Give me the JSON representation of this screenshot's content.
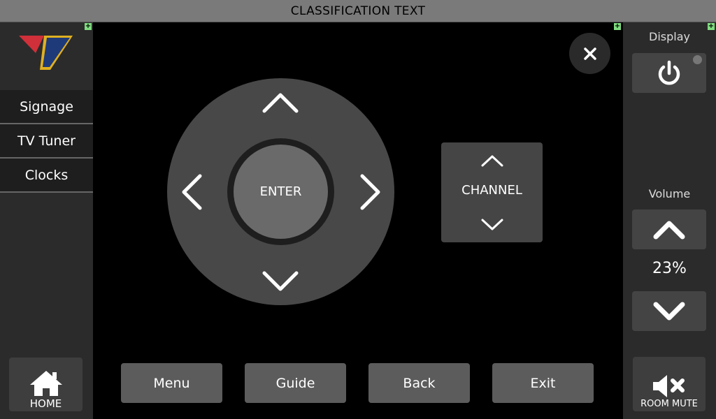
{
  "classification": "CLASSIFICATION TEXT",
  "nav": {
    "items": [
      {
        "label": "Signage"
      },
      {
        "label": "TV Tuner"
      },
      {
        "label": "Clocks"
      }
    ],
    "home_label": "HOME"
  },
  "dpad": {
    "enter_label": "ENTER"
  },
  "channel": {
    "label": "CHANNEL"
  },
  "bottom_buttons": {
    "menu": "Menu",
    "guide": "Guide",
    "back": "Back",
    "exit": "Exit"
  },
  "display": {
    "label": "Display"
  },
  "volume": {
    "label": "Volume",
    "level": "23%"
  },
  "mute": {
    "label": "ROOM MUTE"
  },
  "colors": {
    "accent_plus": "#7fdc7f",
    "logo_red": "#d0303a",
    "logo_blue": "#1f3a78",
    "logo_gold": "#e0b020"
  }
}
